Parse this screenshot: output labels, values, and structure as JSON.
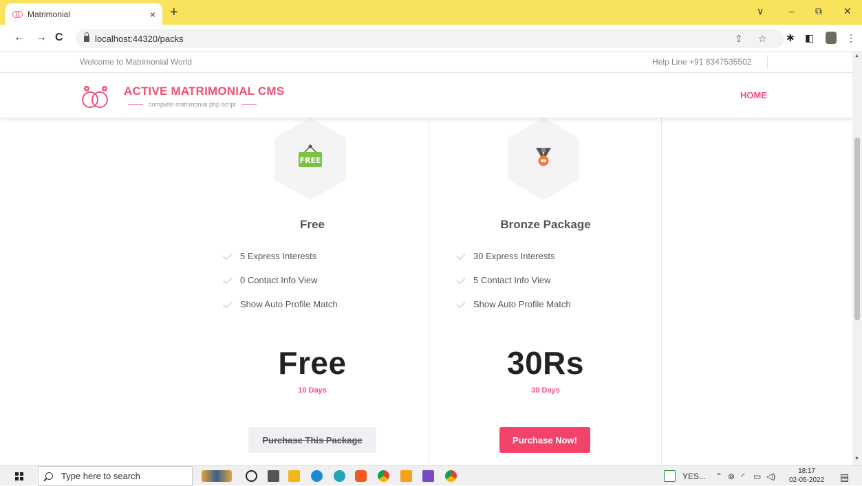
{
  "browser": {
    "tab_title": "Matrimonial",
    "tab_close": "×",
    "new_tab": "+",
    "url": "localhost:44320/packs",
    "window_controls": [
      "∨",
      "–",
      "⧉",
      "✕"
    ],
    "nav": {
      "back": "←",
      "forward": "→",
      "reload": "C"
    },
    "accent_color": "#f9e35d"
  },
  "page": {
    "top_strip": {
      "welcome": "Welcome to Matrimonial World",
      "helpline": "Help Line +91 8347535502"
    },
    "header": {
      "brand": "ACTIVE MATRIMONIAL CMS",
      "tagline": "complete matrimonial php script",
      "nav_home": "HOME",
      "brand_color": "#f0507a"
    },
    "packages": [
      {
        "name": "Free",
        "icon": "free-tag-icon",
        "features": [
          "5 Express Interests",
          "0 Contact Info View",
          "Show Auto Profile Match"
        ],
        "price": "Free",
        "duration": "10 Days",
        "button": "Purchase This Package",
        "button_state": "disabled"
      },
      {
        "name": "Bronze Package",
        "icon": "bronze-medal-icon",
        "features": [
          "30 Express Interests",
          "5 Contact Info View",
          "Show Auto Profile Match"
        ],
        "price": "30Rs",
        "duration": "30 Days",
        "button": "Purchase Now!",
        "button_state": "active"
      }
    ]
  },
  "taskbar": {
    "search_placeholder": "Type here to search",
    "tray_app": "YES...",
    "time": "18:17",
    "date": "02-05-2022"
  }
}
